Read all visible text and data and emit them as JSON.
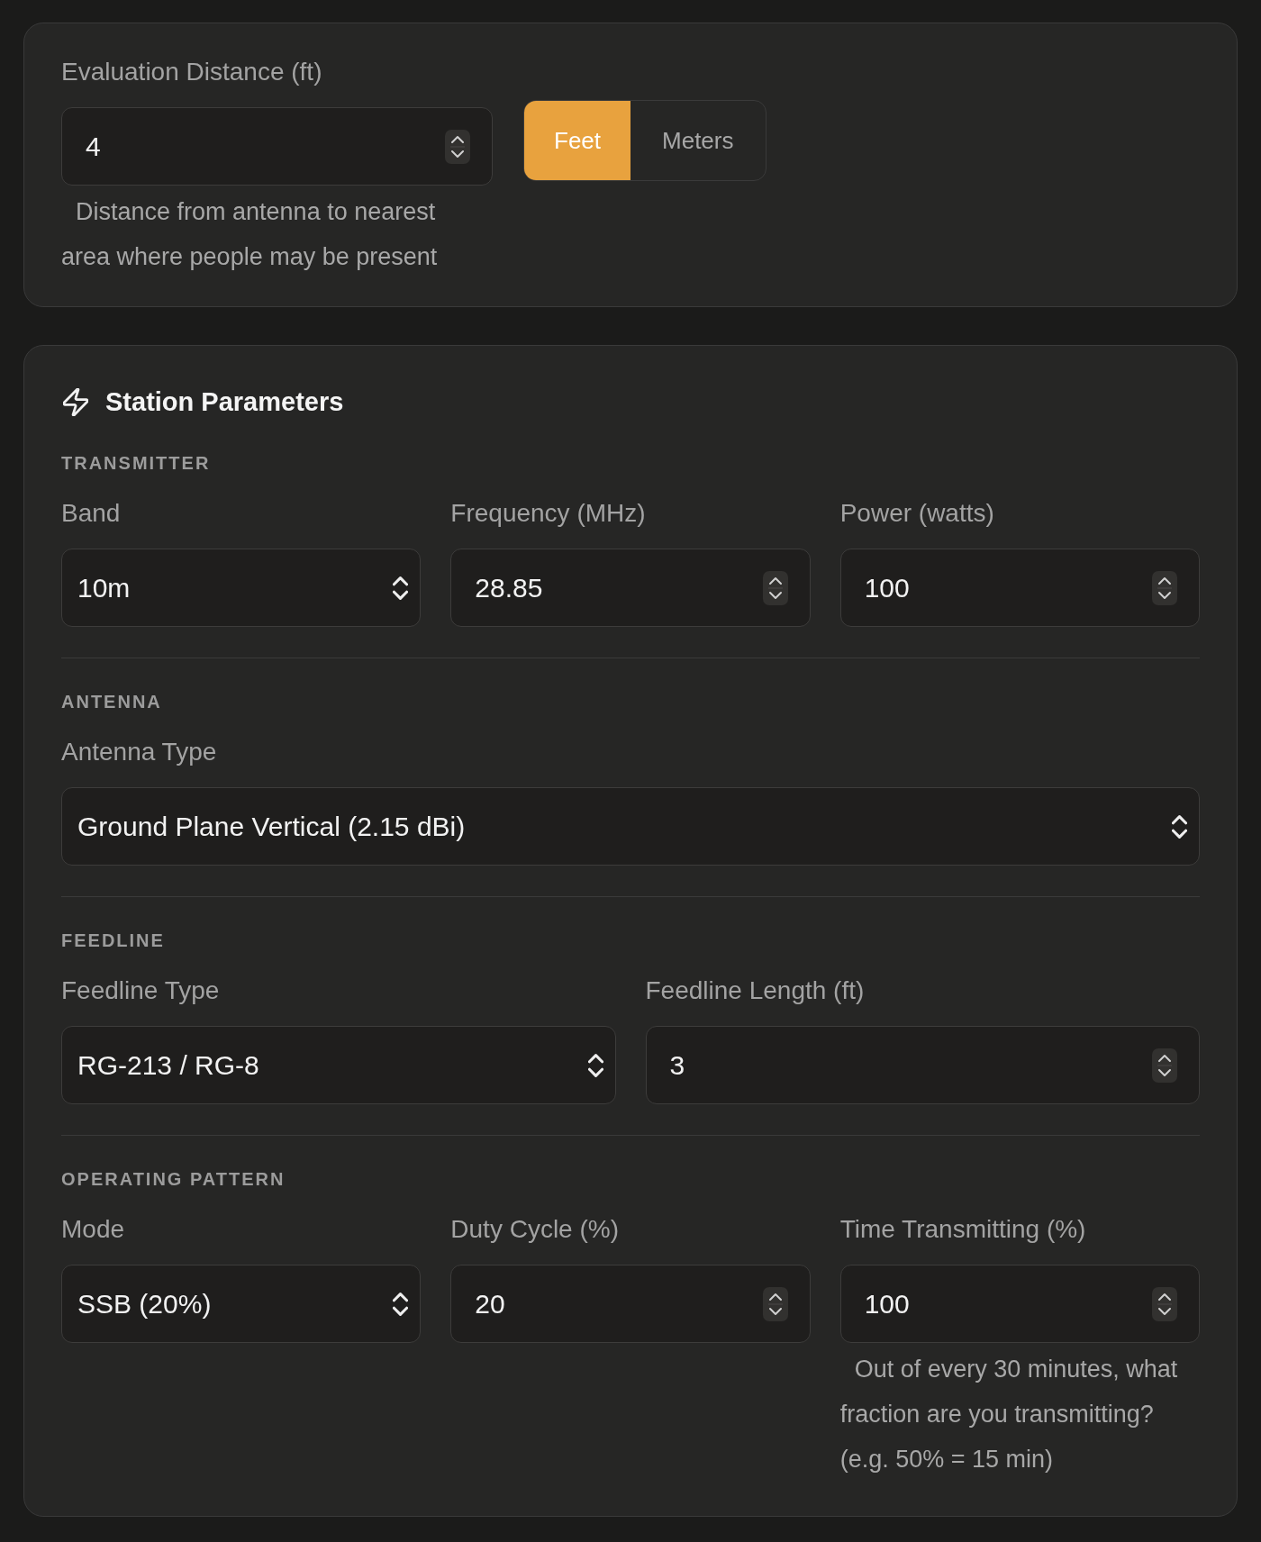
{
  "distance": {
    "label": "Evaluation Distance (ft)",
    "field": {
      "kind": "number",
      "value": "4"
    },
    "units": [
      {
        "label": "Feet",
        "selected": true
      },
      {
        "label": "Meters",
        "selected": false
      }
    ],
    "helper": "Distance from antenna to nearest area where people may be present"
  },
  "station_parameters": {
    "title": "Station Parameters",
    "sections": [
      {
        "heading": "TRANSMITTER",
        "fields": [
          {
            "kind": "select",
            "label": "Band",
            "value": "10m"
          },
          {
            "kind": "number",
            "label": "Frequency (MHz)",
            "value": "28.85"
          },
          {
            "kind": "number",
            "label": "Power (watts)",
            "value": "100"
          }
        ]
      },
      {
        "heading": "ANTENNA",
        "fields": [
          {
            "kind": "select",
            "label": "Antenna Type",
            "value": "Ground Plane Vertical (2.15 dBi)"
          }
        ]
      },
      {
        "heading": "FEEDLINE",
        "fields": [
          {
            "kind": "select",
            "label": "Feedline Type",
            "value": "RG-213 / RG-8"
          },
          {
            "kind": "number",
            "label": "Feedline Length (ft)",
            "value": "3"
          }
        ]
      },
      {
        "heading": "OPERATING PATTERN",
        "fields": [
          {
            "kind": "select",
            "label": "Mode",
            "value": "SSB (20%)"
          },
          {
            "kind": "number",
            "label": "Duty Cycle (%)",
            "value": "20"
          },
          {
            "kind": "number",
            "label": "Time Transmitting (%)",
            "value": "100",
            "helper": "Out of every 30 minutes, what fraction are you transmitting? (e.g. 50% = 15 min)"
          }
        ]
      }
    ]
  }
}
